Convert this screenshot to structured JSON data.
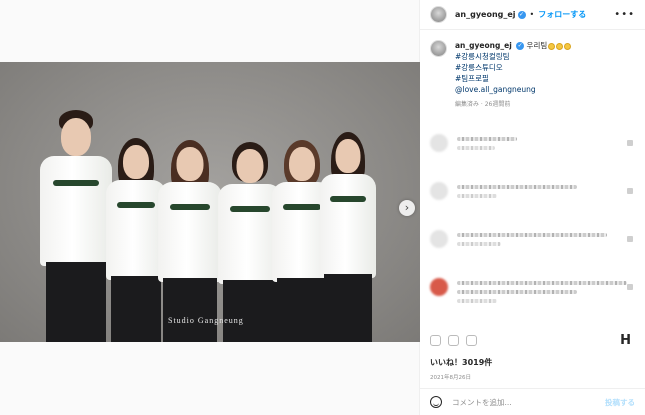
{
  "post": {
    "photo_watermark": "Studio Gangneung",
    "next_arrow": "›"
  },
  "header": {
    "username": "an_gyeong_ej",
    "verified_mark": "✓",
    "separator": "•",
    "follow_label": "フォローする",
    "more_icon": "•••"
  },
  "caption": {
    "username": "an_gyeong_ej",
    "text": "우리팀",
    "emoji_count": 3,
    "hashtags": [
      "#강릉시청컬링팀",
      "#강릉스튜디오",
      "#팀프로필"
    ],
    "mention": "@love.all_gangneung",
    "meta": "編集済み · 26週間前"
  },
  "comments_note": "comment text is blurred/pixelated in the screenshot",
  "likes": "いいね！3019件",
  "date": "2021年8月26日",
  "bookmark_icon": "H",
  "comment_bar": {
    "placeholder": "コメントを追加...",
    "post_label": "投稿する"
  },
  "colors": {
    "link_blue": "#0095f6",
    "hashtag_blue": "#00376b",
    "jacket_green": "#27472d"
  }
}
